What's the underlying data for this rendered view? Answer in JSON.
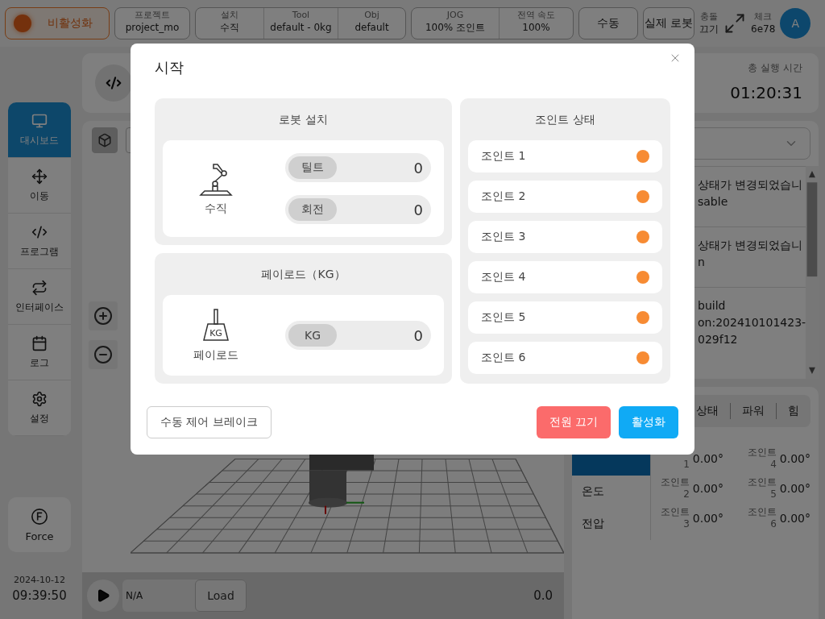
{
  "topbar": {
    "status_button": "비활성화",
    "project": {
      "label": "프로젝트",
      "value": "project_mo"
    },
    "install": [
      {
        "label": "설치",
        "value": "수직"
      },
      {
        "label": "Tool",
        "value": "default - 0kg"
      },
      {
        "label": "Obj",
        "value": "default"
      }
    ],
    "jog": [
      {
        "label": "JOG",
        "value": "100% 조인트"
      },
      {
        "label": "전역 속도",
        "value": "100%"
      }
    ],
    "mode_button": "수동",
    "robot_button": "실제 로봇",
    "collision": {
      "label": "충돌",
      "value": "끄기"
    },
    "check": {
      "label": "체크",
      "value": "6e78"
    },
    "avatar": "A"
  },
  "sidebar": {
    "items": [
      {
        "label": "대시보드",
        "selected": true
      },
      {
        "label": "이동",
        "selected": false
      },
      {
        "label": "프로그램",
        "selected": false
      },
      {
        "label": "인터페이스",
        "selected": false
      },
      {
        "label": "로그",
        "selected": false
      },
      {
        "label": "설정",
        "selected": false
      }
    ],
    "force": "Force",
    "date": "2024-10-12",
    "time": "09:39:50"
  },
  "viewer": {
    "file": "N/A",
    "load_button": "Load",
    "value": "0.0"
  },
  "runtime": {
    "label": "총 실행 시간",
    "value": "01:20:31"
  },
  "log": {
    "entries": [
      {
        "lines": [
          "상태가 변경되었습니",
          "sable"
        ]
      },
      {
        "lines": [
          "상태가 변경되었습니",
          "n"
        ]
      },
      {
        "lines": [
          "build",
          "on:202410101423-",
          "029f12"
        ]
      }
    ]
  },
  "status_panel": {
    "tabs": [
      "상태",
      "파워",
      "힘"
    ],
    "items": [
      {
        "selected": true
      },
      {
        "label": "온도",
        "selected": false
      },
      {
        "label": "전압",
        "selected": false
      }
    ],
    "joints": [
      {
        "label": "1",
        "value": "0.00°"
      },
      {
        "label": "조인트 2",
        "value": "0.00°"
      },
      {
        "label": "조인트 3",
        "value": "0.00°"
      },
      {
        "label": "조인트 4",
        "value": "0.00°"
      },
      {
        "label": "조인트 5",
        "value": "0.00°"
      },
      {
        "label": "조인트 6",
        "value": "0.00°"
      }
    ]
  },
  "modal": {
    "title": "시작",
    "install": {
      "title": "로봇 설치",
      "caption": "수직",
      "fields": [
        {
          "label": "틸트",
          "value": "0"
        },
        {
          "label": "회전",
          "value": "0"
        }
      ]
    },
    "payload": {
      "title": "페이로드（KG）",
      "caption": "페이로드",
      "icon_text": "KG",
      "fields": [
        {
          "label": "KG",
          "value": "0"
        }
      ]
    },
    "joints": {
      "title": "조인트 상태",
      "items": [
        {
          "label": "조인트 1",
          "color": "#f78b33"
        },
        {
          "label": "조인트 2",
          "color": "#f78b33"
        },
        {
          "label": "조인트 3",
          "color": "#f78b33"
        },
        {
          "label": "조인트 4",
          "color": "#f78b33"
        },
        {
          "label": "조인트 5",
          "color": "#f78b33"
        },
        {
          "label": "조인트 6",
          "color": "#f78b33"
        }
      ]
    },
    "brake_button": "수동 제어 브레이크",
    "power_off_button": "전원 끄기",
    "activate_button": "활성화"
  }
}
